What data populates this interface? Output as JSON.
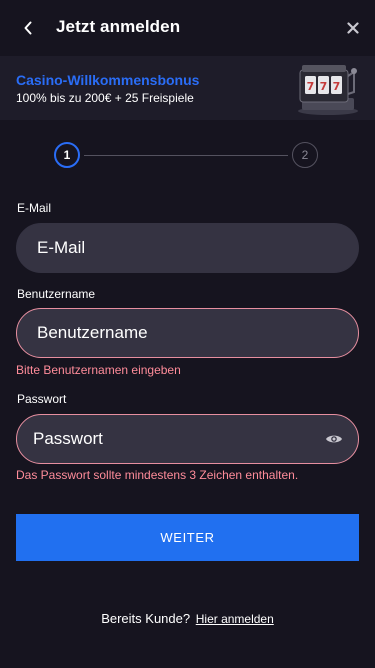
{
  "header": {
    "title": "Jetzt anmelden",
    "back_icon": "chevron-left-icon",
    "close_icon": "close-icon"
  },
  "bonus": {
    "title": "Casino-Willkommensbonus",
    "subtitle": "100% bis zu 200€ + 25 Freispiele",
    "image_icon": "slot-machine-icon"
  },
  "stepper": {
    "steps": [
      "1",
      "2"
    ],
    "current": 1
  },
  "form": {
    "email": {
      "label": "E-Mail",
      "placeholder": "E-Mail",
      "value": ""
    },
    "username": {
      "label": "Benutzername",
      "placeholder": "Benutzername",
      "value": "",
      "error": "Bitte Benutzernamen eingeben"
    },
    "password": {
      "label": "Passwort",
      "placeholder": "Passwort",
      "value": "",
      "error": "Das Passwort sollte mindestens 3 Zeichen enthalten.",
      "toggle_icon": "eye-icon"
    },
    "submit_label": "WEITER"
  },
  "footer": {
    "prompt": "Bereits Kunde?",
    "link": "Hier anmelden"
  },
  "colors": {
    "background": "#16141f",
    "banner": "#1e1c29",
    "accent": "#2170f0",
    "field": "#353342",
    "error": "#ff8c9a"
  }
}
